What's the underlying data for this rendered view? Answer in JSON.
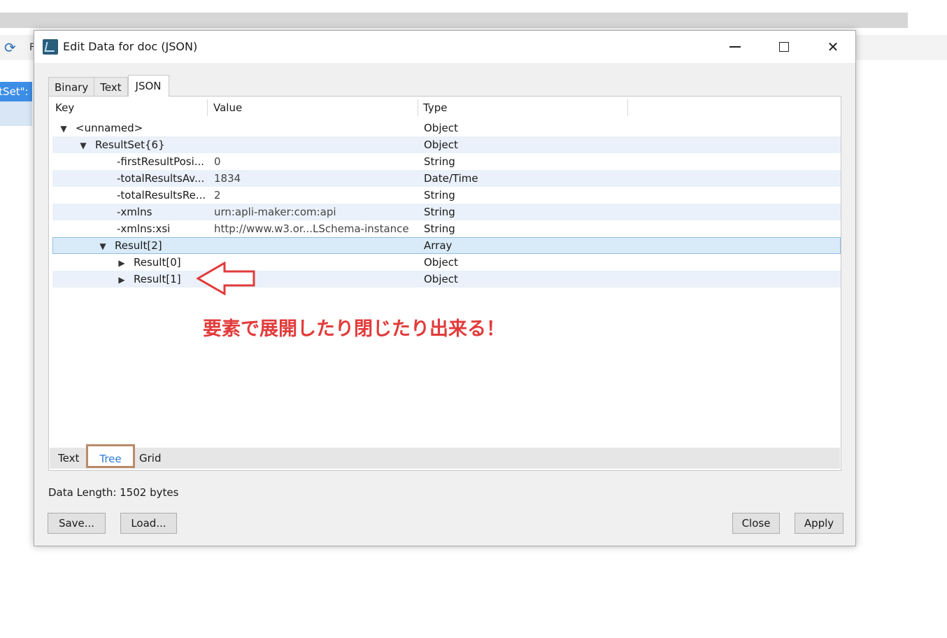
{
  "dialog": {
    "title": "Edit Data for doc (JSON)",
    "tabs": [
      "Binary",
      "Text",
      "JSON"
    ],
    "active_tab": "JSON"
  },
  "background": {
    "partial_label": "ltSet\":",
    "partial_letter": "F"
  },
  "tree": {
    "headers": {
      "key": "Key",
      "value": "Value",
      "type": "Type"
    },
    "rows": [
      {
        "key": "<unnamed>",
        "value": "",
        "type": "Object",
        "toggle": "▼"
      },
      {
        "key": "ResultSet{6}",
        "value": "",
        "type": "Object",
        "toggle": "▼"
      },
      {
        "key": "-firstResultPosi...",
        "value": "0",
        "type": "String",
        "toggle": ""
      },
      {
        "key": "-totalResultsAv...",
        "value": "1834",
        "type": "Date/Time",
        "toggle": ""
      },
      {
        "key": "-totalResultsRe...",
        "value": "2",
        "type": "String",
        "toggle": ""
      },
      {
        "key": "-xmlns",
        "value": "urn:apli-maker:com:api",
        "type": "String",
        "toggle": ""
      },
      {
        "key": "-xmlns:xsi",
        "value": "http://www.w3.or...LSchema-instance",
        "type": "String",
        "toggle": ""
      },
      {
        "key": "Result[2]",
        "value": "",
        "type": "Array",
        "toggle": "▼"
      },
      {
        "key": "Result[0]",
        "value": "",
        "type": "Object",
        "toggle": "▶"
      },
      {
        "key": "Result[1]",
        "value": "",
        "type": "Object",
        "toggle": "▶"
      }
    ],
    "selected_row": "Result[2]"
  },
  "view_tabs": {
    "text": "Text",
    "tree": "Tree",
    "grid": "Grid",
    "active": "Tree"
  },
  "footer": {
    "data_length": "Data Length: 1502 bytes",
    "save": "Save...",
    "load": "Load...",
    "close": "Close",
    "apply": "Apply"
  },
  "annotation": {
    "text": "要素で展開したり閉じたり出来る！",
    "color": "#e23b3b"
  },
  "colors": {
    "selection": "#d9ebf9",
    "alt_row": "#eaf1fa",
    "tree_tab_highlight": "#b98b6a",
    "tree_tab_text": "#2d7bd6"
  }
}
